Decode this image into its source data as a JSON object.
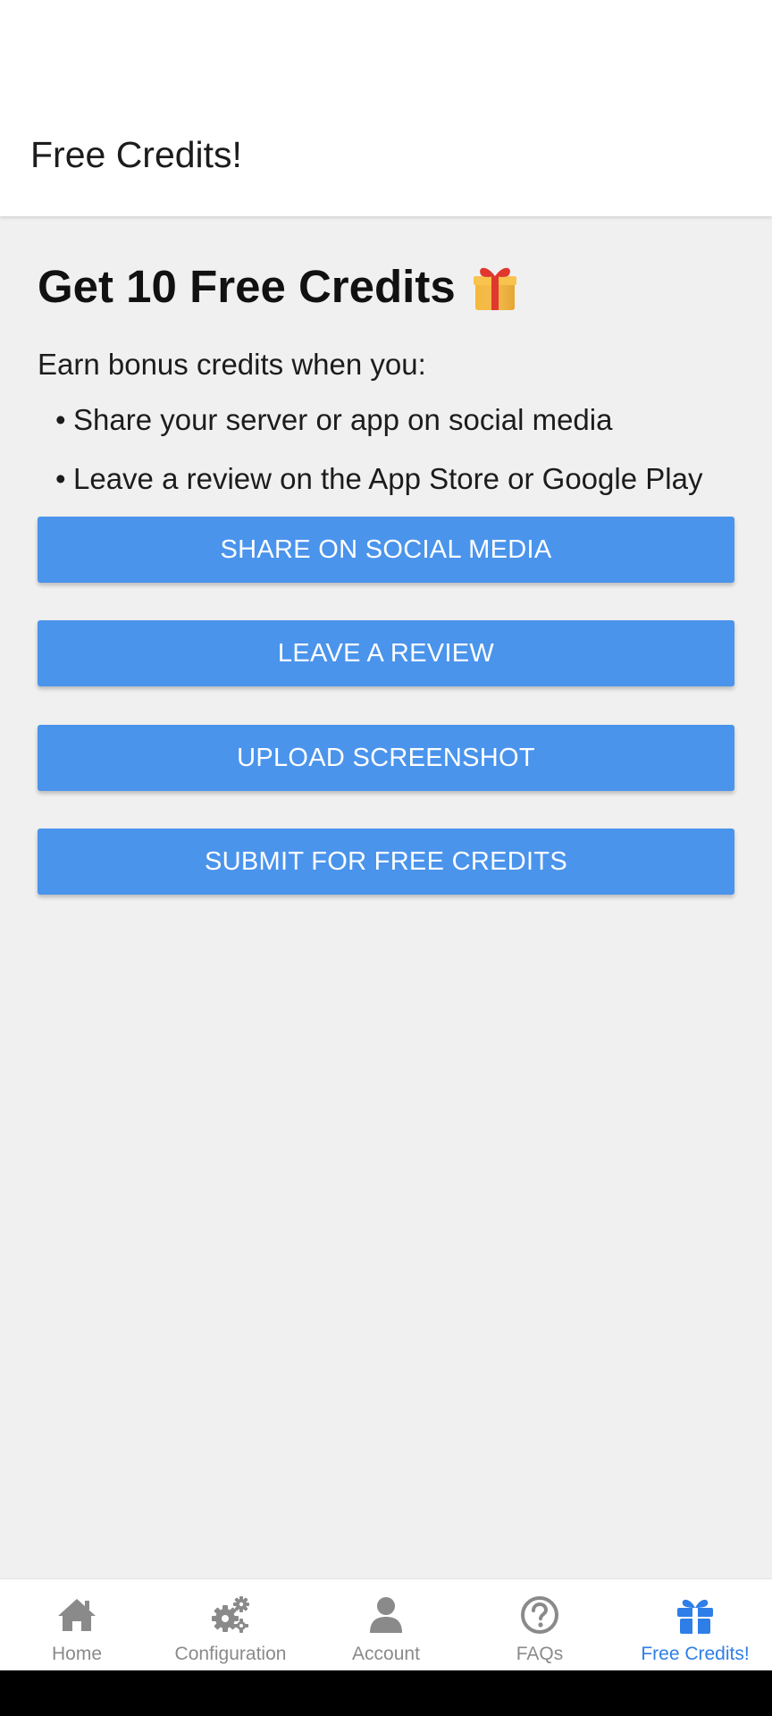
{
  "header": {
    "title": "Free Credits!"
  },
  "main": {
    "headline": "Get 10 Free Credits",
    "headline_icon": "gift-emoji",
    "intro": "Earn bonus credits when you:",
    "bullets": [
      "Share your server or app on social media",
      "Leave a review on the App Store or Google Play"
    ],
    "buttons": {
      "share": "SHARE ON SOCIAL MEDIA",
      "review": "LEAVE A REVIEW",
      "upload": "UPLOAD SCREENSHOT",
      "submit": "SUBMIT FOR FREE CREDITS"
    },
    "button_color": "#4a94ec"
  },
  "tabbar": {
    "active_tab": "Free Credits!",
    "active_color": "#2f7ee8",
    "inactive_color": "#8a8a8a",
    "tabs": [
      {
        "label": "Home",
        "icon": "home-icon"
      },
      {
        "label": "Configuration",
        "icon": "gears-icon"
      },
      {
        "label": "Account",
        "icon": "user-icon"
      },
      {
        "label": "FAQs",
        "icon": "question-circle-icon"
      },
      {
        "label": "Free Credits!",
        "icon": "gift-icon"
      }
    ]
  }
}
